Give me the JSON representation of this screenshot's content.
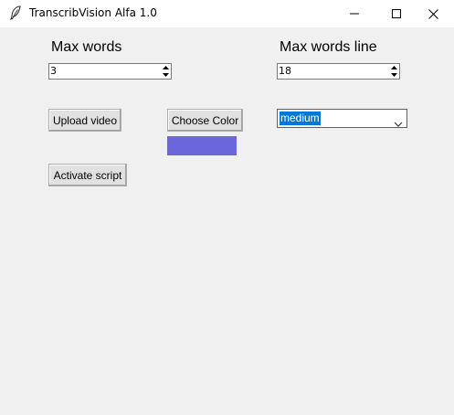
{
  "window": {
    "title": "TranscribVision Alfa 1.0",
    "app_icon": "feather-icon",
    "controls": [
      "minimize-icon",
      "maximize-icon",
      "close-icon"
    ]
  },
  "left_panel": {
    "heading": "Max words",
    "spinbox_value": "3",
    "upload_button": "Upload video",
    "activate_button": "Activate script"
  },
  "middle_panel": {
    "color_button": "Choose Color",
    "selected_color": "#6b66d9"
  },
  "right_panel": {
    "heading": "Max words line",
    "spinbox_value": "18",
    "combobox_value": "medium"
  },
  "colors": {
    "selection_highlight": "#0078d7",
    "window_background": "#f0f0f0"
  }
}
